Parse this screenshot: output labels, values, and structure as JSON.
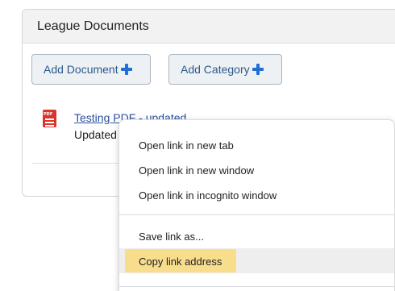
{
  "panel": {
    "title": "League Documents",
    "add_document_label": "Add Document",
    "add_category_label": "Add Category"
  },
  "document": {
    "link_text": "Testing PDF - updated",
    "updated_text": "Updated",
    "icon": "pdf-file-icon",
    "icon_tag": "PDF"
  },
  "context_menu": {
    "items": [
      "Open link in new tab",
      "Open link in new window",
      "Open link in incognito window",
      "Save link as...",
      "Copy link address"
    ],
    "highlighted_item": "Copy link address",
    "highlight_color": "#f8dd8c"
  },
  "colors": {
    "link": "#2a4f9c",
    "plus_icon": "#1f6fd6",
    "pdf_icon": "#d9342b"
  }
}
